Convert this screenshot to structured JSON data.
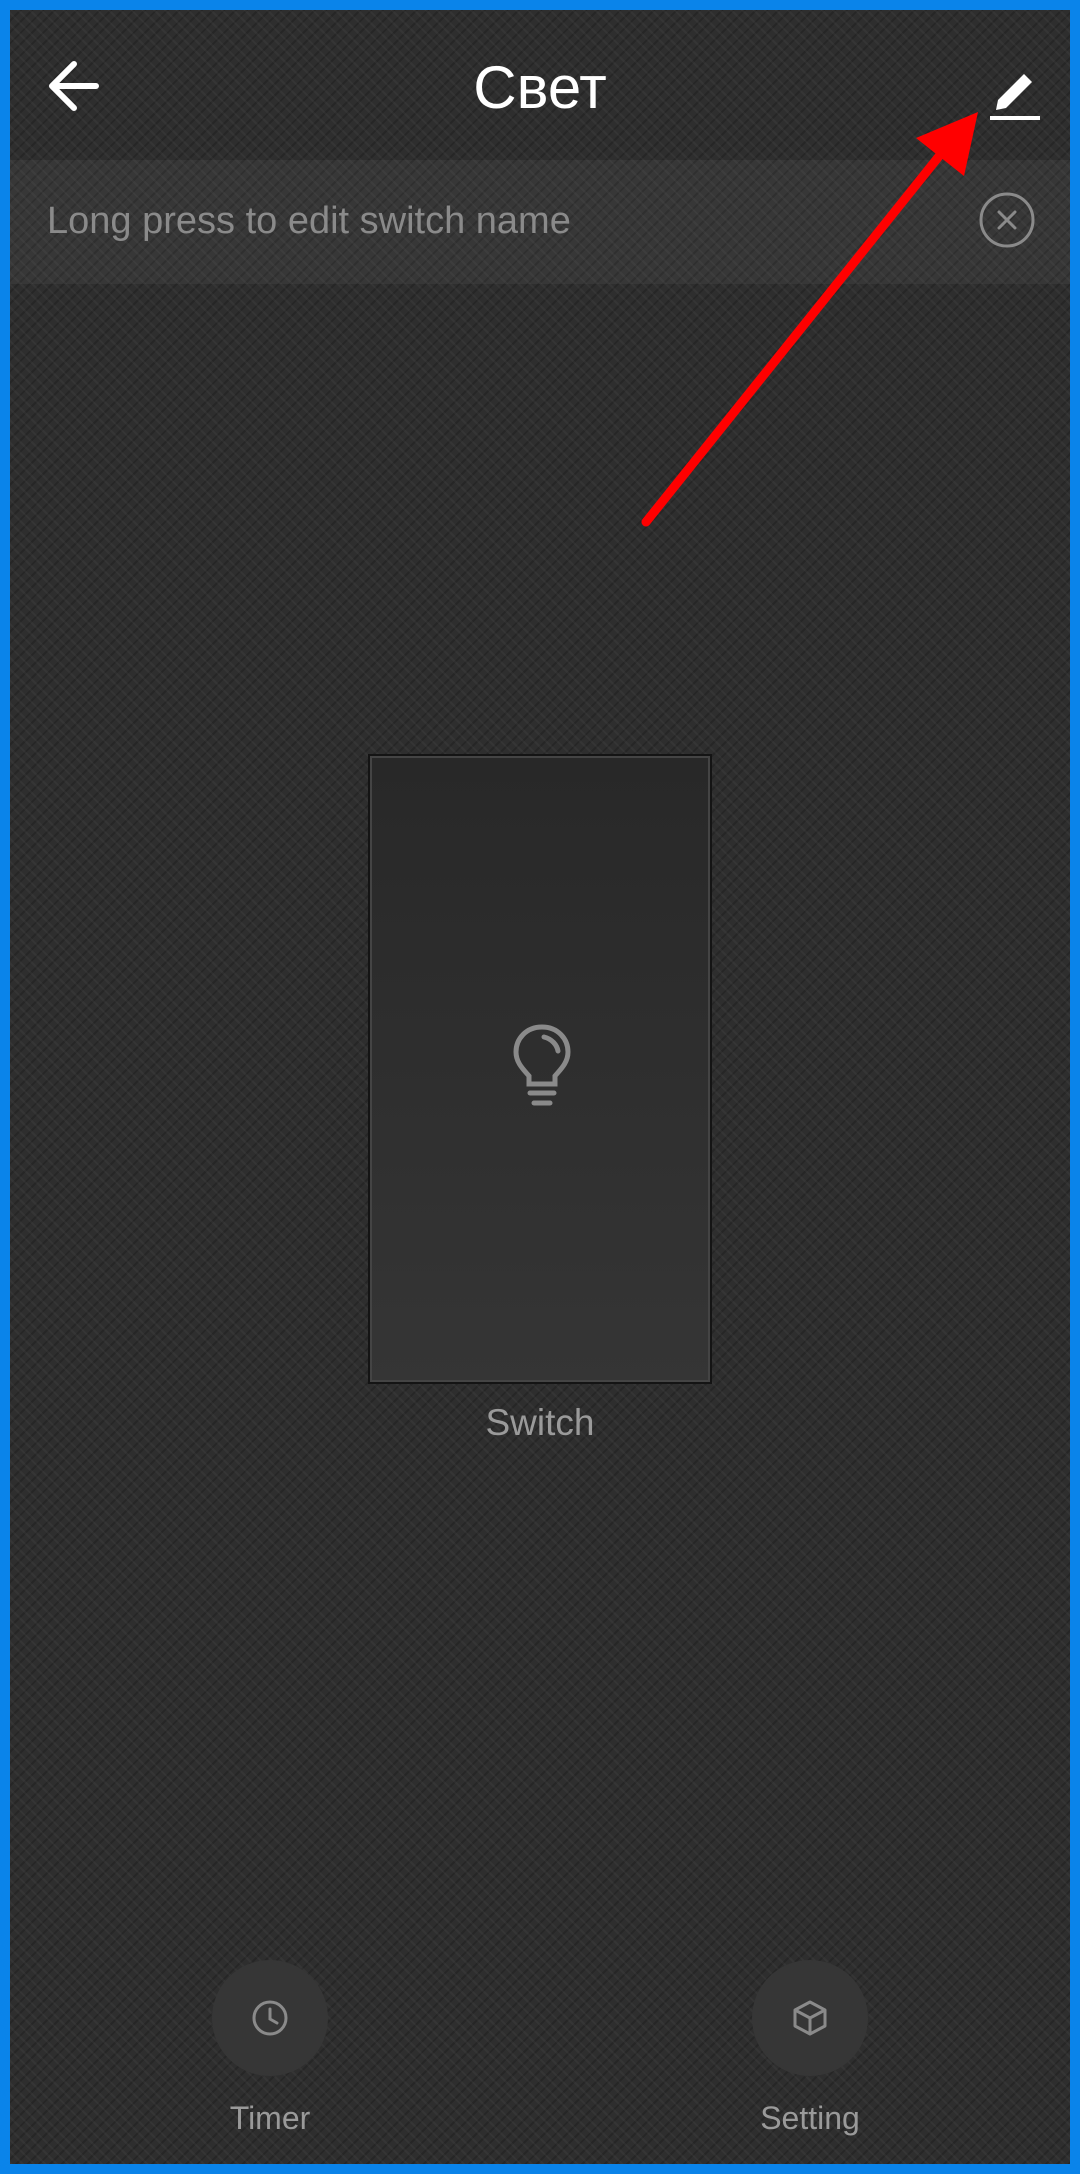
{
  "header": {
    "title": "Свет"
  },
  "banner": {
    "text": "Long press to edit switch name"
  },
  "switch": {
    "label": "Switch",
    "state": "off"
  },
  "bottom_nav": {
    "timer_label": "Timer",
    "setting_label": "Setting"
  },
  "colors": {
    "frame": "#0a84ea",
    "background": "#2e2e2e",
    "annotation_arrow": "#ff0000"
  }
}
